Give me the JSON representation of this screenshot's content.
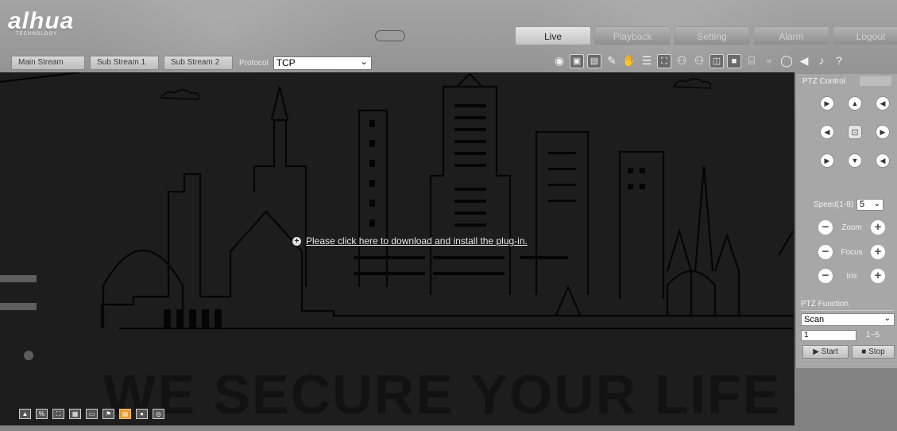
{
  "brand": {
    "name": "alhua",
    "tagline": "TECHNOLOGY"
  },
  "nav": {
    "tabs": [
      {
        "label": "Live",
        "active": true
      },
      {
        "label": "Playback",
        "active": false
      },
      {
        "label": "Setting",
        "active": false
      },
      {
        "label": "Alarm",
        "active": false
      },
      {
        "label": "Logout",
        "active": false
      }
    ]
  },
  "toolbar": {
    "main_stream": "Main Stream",
    "sub_stream_1": "Sub Stream 1",
    "sub_stream_2": "Sub Stream 2",
    "protocol_label": "Protocol",
    "protocol_value": "TCP"
  },
  "video": {
    "plugin_message": "Please click here to download and install the plug-in.",
    "watermark": "WE SECURE YOUR LIFE"
  },
  "ptz": {
    "title": "PTZ Control",
    "speed_label": "Speed(1-8)",
    "speed_value": "5",
    "zoom_label": "Zoom",
    "focus_label": "Focus",
    "iris_label": "Iris",
    "function_title": "PTZ Function",
    "function_value": "Scan",
    "input_value": "1",
    "range": "1~5",
    "start_label": "▶ Start",
    "stop_label": "■ Stop"
  },
  "colors": {
    "accent_orange": "#e99a29"
  }
}
